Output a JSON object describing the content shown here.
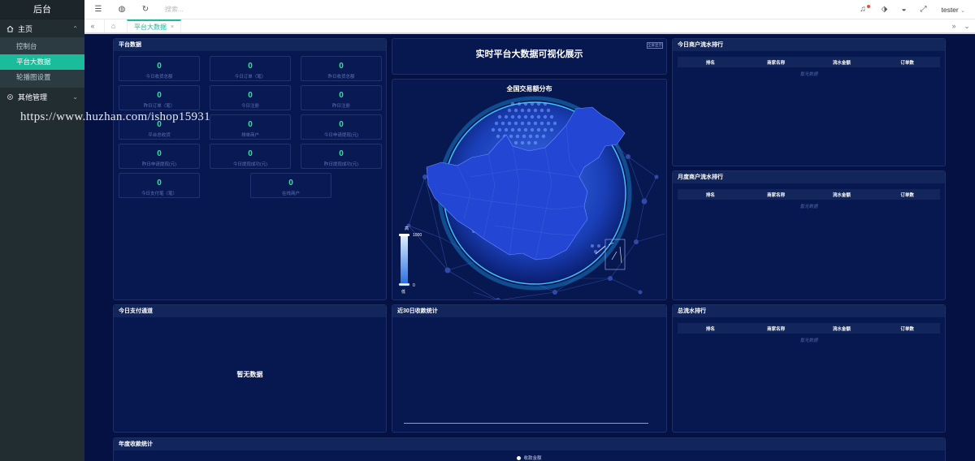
{
  "sidebar": {
    "logo": "后台",
    "groups": [
      {
        "label": "主页",
        "items": [
          "控制台",
          "平台大数据",
          "轮播图设置"
        ]
      },
      {
        "label": "其他管理",
        "items": []
      }
    ]
  },
  "watermark": "https://www.huzhan.com/ishop15931",
  "topbar": {
    "search_placeholder": "搜索...",
    "user": "tester"
  },
  "tabs": [
    {
      "label": "平台大数据"
    }
  ],
  "dashboard": {
    "title": "实时平台大数据可视化展示",
    "fullscreen_label": "全屏显示",
    "platform": {
      "heading": "平台数据",
      "stats": [
        {
          "value": "0",
          "label": "今日收货总额"
        },
        {
          "value": "0",
          "label": "今日订单（笔）"
        },
        {
          "value": "0",
          "label": "昨日收货总额"
        },
        {
          "value": "0",
          "label": "昨日订单（笔）"
        },
        {
          "value": "0",
          "label": "今日注册"
        },
        {
          "value": "0",
          "label": "昨日注册"
        },
        {
          "value": "0",
          "label": "平台总收货"
        },
        {
          "value": "0",
          "label": "排单商户"
        },
        {
          "value": "0",
          "label": "今日申请提现(元)"
        },
        {
          "value": "0",
          "label": "昨日申请提现(元)"
        },
        {
          "value": "0",
          "label": "今日提现成功(元)"
        },
        {
          "value": "0",
          "label": "昨日提现成功(元)"
        },
        {
          "value": "0",
          "label": "今日支付笔（笔）"
        },
        {
          "value": "0",
          "label": "在线商户"
        }
      ]
    },
    "map": {
      "title": "全国交易额分布",
      "scale_high": "高",
      "scale_max": "1000",
      "scale_min": "0",
      "scale_low": "低"
    },
    "rank_columns": [
      "排名",
      "商家名称",
      "流水金额",
      "订单数"
    ],
    "rank_empty": "暂无数据",
    "today_rank_heading": "今日商户流水排行",
    "month_rank_heading": "月度商户流水排行",
    "total_rank_heading": "总流水排行",
    "channel": {
      "heading": "今日支付通道",
      "empty": "暂无数据"
    },
    "recent30_heading": "近30日收款统计",
    "yearly": {
      "heading": "年度收款统计",
      "legend": "收款金额"
    }
  },
  "colors": {
    "accent": "#1abc9c",
    "value": "#37e09a",
    "bg": "#041142"
  }
}
